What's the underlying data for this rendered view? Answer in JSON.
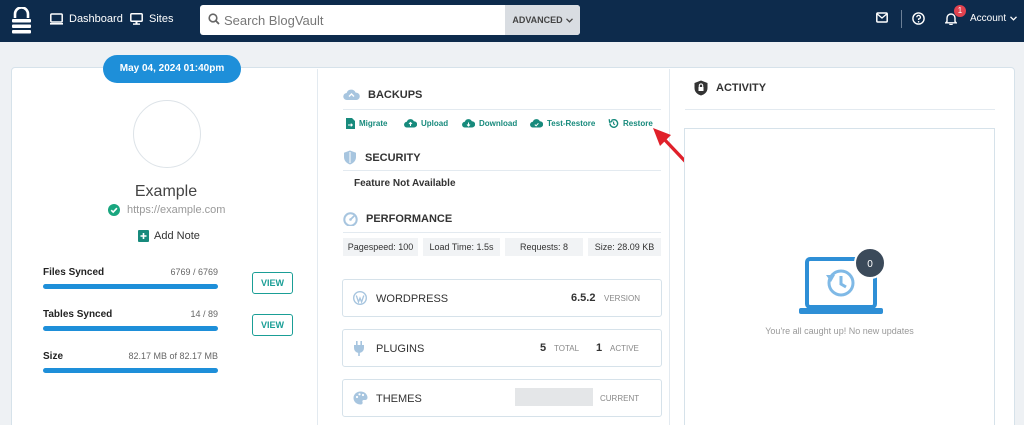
{
  "topbar": {
    "dashboard_label": "Dashboard",
    "sites_label": "Sites",
    "search_placeholder": "Search BlogVault",
    "advanced_label": "ADVANCED",
    "notification_count": "1",
    "account_label": "Account"
  },
  "site": {
    "date": "May 04, 2024 01:40pm",
    "name": "Example",
    "url": "https://example.com",
    "add_note": "Add Note",
    "sync": [
      {
        "label": "Files Synced",
        "value": "6769 / 6769",
        "progress": 1.0,
        "button": "VIEW"
      },
      {
        "label": "Tables Synced",
        "value": "14 / 89",
        "progress": 1.0,
        "button": "VIEW"
      },
      {
        "label": "Size",
        "value": "82.17 MB of 82.17 MB",
        "progress": 1.0
      }
    ]
  },
  "backups": {
    "title": "BACKUPS",
    "actions": [
      "Migrate",
      "Upload",
      "Download",
      "Test-Restore",
      "Restore"
    ]
  },
  "security": {
    "title": "SECURITY",
    "status": "Feature Not Available"
  },
  "performance": {
    "title": "PERFORMANCE",
    "pagespeed": "Pagespeed: 100",
    "load_time": "Load Time: 1.5s",
    "requests": "Requests: 8",
    "size": "Size: 28.09 KB"
  },
  "wordpress": {
    "title": "WORDPRESS",
    "version": "6.5.2",
    "version_label": "VERSION"
  },
  "plugins": {
    "title": "PLUGINS",
    "total": "5",
    "total_label": "TOTAL",
    "active": "1",
    "active_label": "ACTIVE"
  },
  "themes": {
    "title": "THEMES",
    "current_label": "CURRENT"
  },
  "activity": {
    "title": "ACTIVITY",
    "count": "0",
    "empty_text": "You're all caught up! No new updates"
  },
  "colors": {
    "navbar": "#0d2b4c",
    "accent_blue": "#1e8fd9",
    "accent_teal": "#178a7c",
    "badge_red": "#e0424f",
    "annotation_arrow": "#e0202a"
  }
}
